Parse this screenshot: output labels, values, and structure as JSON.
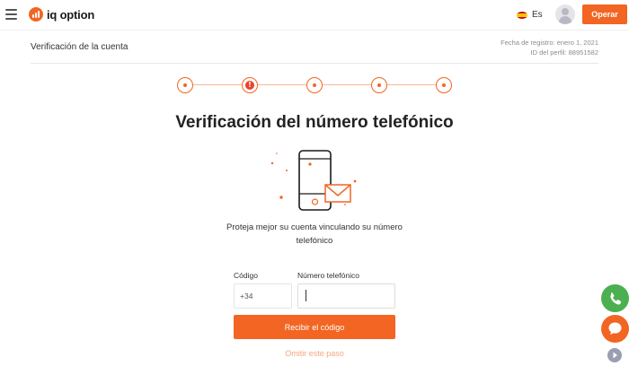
{
  "header": {
    "logo_text": "iq option",
    "language": "Es",
    "cta_label": "Operar"
  },
  "subheader": {
    "title": "Verificación de la cuenta",
    "registration": "Fecha de registro: enero 1, 2021",
    "profile_id": "ID del perfil: 88951582"
  },
  "steps": {
    "count": 5,
    "active_index": 1
  },
  "main": {
    "title": "Verificación del número telefónico",
    "description": "Proteja mejor su cuenta vinculando su número telefónico"
  },
  "form": {
    "code_label": "Código",
    "code_value": "+34",
    "phone_label": "Número telefónico",
    "phone_value": "",
    "submit_label": "Recibir el código",
    "skip_label": "Omitir este paso"
  },
  "colors": {
    "accent": "#f26522",
    "call": "#4caf50"
  },
  "icons": {
    "menu": "hamburger-icon",
    "phone": "phone-icon",
    "chat": "chat-icon",
    "play": "play-icon"
  }
}
